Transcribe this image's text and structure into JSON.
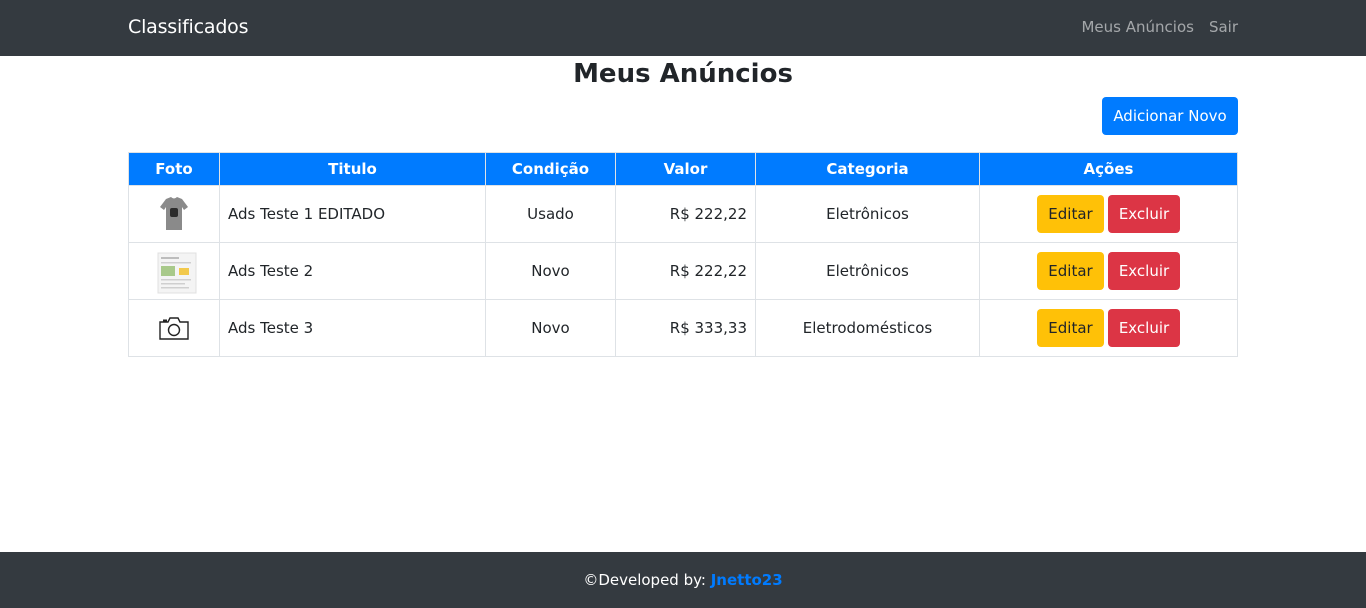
{
  "navbar": {
    "brand": "Classificados",
    "links": [
      "Meus Anúncios",
      "Sair"
    ]
  },
  "page": {
    "title": "Meus Anúncios",
    "add_button": "Adicionar Novo"
  },
  "table": {
    "headers": [
      "Foto",
      "Titulo",
      "Condição",
      "Valor",
      "Categoria",
      "Ações"
    ],
    "rows": [
      {
        "photo_icon": "tshirt-photo",
        "title": "Ads Teste 1 EDITADO",
        "condition": "Usado",
        "price": "R$ 222,22",
        "category": "Eletrônicos",
        "edit": "Editar",
        "delete": "Excluir"
      },
      {
        "photo_icon": "document-photo",
        "title": "Ads Teste 2",
        "condition": "Novo",
        "price": "R$ 222,22",
        "category": "Eletrônicos",
        "edit": "Editar",
        "delete": "Excluir"
      },
      {
        "photo_icon": "camera-icon",
        "title": "Ads Teste 3",
        "condition": "Novo",
        "price": "R$ 333,33",
        "category": "Eletrodomésticos",
        "edit": "Editar",
        "delete": "Excluir"
      }
    ]
  },
  "footer": {
    "prefix": "©Developed by: ",
    "author": "Jnetto23"
  },
  "colors": {
    "primary": "#007bff",
    "warning": "#ffc107",
    "danger": "#dc3545",
    "dark": "#343a40"
  }
}
